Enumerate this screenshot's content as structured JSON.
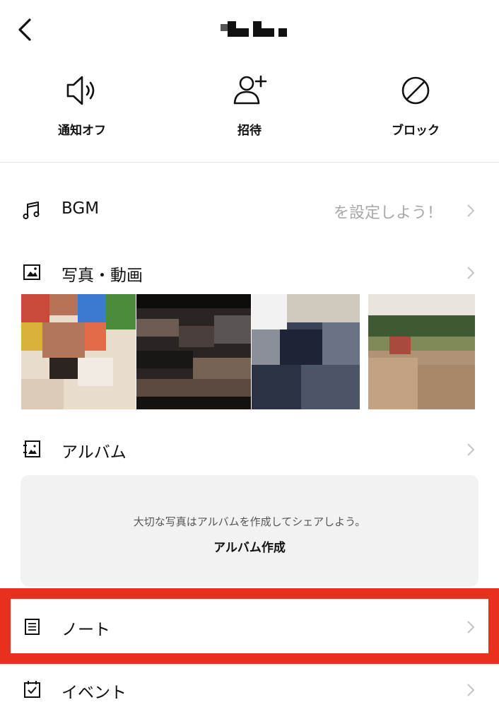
{
  "header": {
    "title": "",
    "back_icon": "chevron-left-icon"
  },
  "actions": [
    {
      "label": "通知オフ",
      "icon": "speaker-icon"
    },
    {
      "label": "招待",
      "icon": "add-user-icon"
    },
    {
      "label": "ブロック",
      "icon": "block-icon"
    }
  ],
  "menu": {
    "bgm": {
      "label": "BGM",
      "value": "を設定しよう！",
      "icon": "music-note-icon"
    },
    "photos": {
      "label": "写真・動画",
      "icon": "photo-icon"
    },
    "album": {
      "label": "アルバム",
      "icon": "album-icon"
    },
    "note": {
      "label": "ノート",
      "icon": "note-icon"
    },
    "event": {
      "label": "イベント",
      "icon": "calendar-icon"
    }
  },
  "album_card": {
    "message": "大切な写真はアルバムを作成してシェアしよう。",
    "create_label": "アルバム作成"
  },
  "colors": {
    "highlight": "#e8301f",
    "card_bg": "#f2f2f2",
    "muted": "#a8a8a8"
  }
}
